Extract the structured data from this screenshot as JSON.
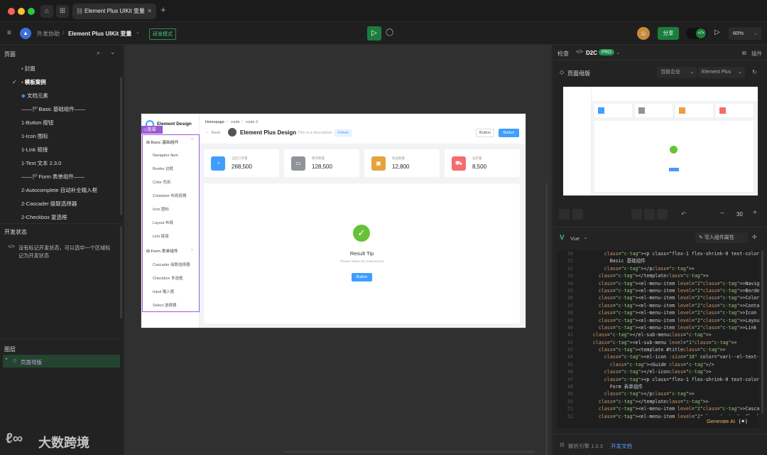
{
  "window": {
    "tab_title": "Element Plus UIKit 变量"
  },
  "toolbar": {
    "breadcrumb_team": "外发协助",
    "breadcrumb_sep": "/",
    "project_name": "Element Plus UIKit 变量",
    "dev_mode_badge": "研发模式",
    "share_label": "分享",
    "zoom": "60%"
  },
  "left": {
    "pages_title": "页面",
    "pages": [
      "封面",
      "模板案例",
      "文档元素",
      "——🏴Basic 基础组件——",
      "1-Button 按钮",
      "1-Icon 图标",
      "1-Link 链接",
      "1-Text 文本 2.3.0",
      "——🏴Form 表单组件——",
      "2-Autocomplete 自动补全输入框",
      "2-Cascader 级联选择器",
      "2-Checkbox 复选框"
    ],
    "dev_status_title": "开发状态",
    "dev_status_desc_1": "没有标记开发状态，可以选中一个区域标",
    "dev_status_desc_2": "记为开发状态",
    "layers_title": "图层",
    "layer_item": "页面母版",
    "watermark": "大数跨境"
  },
  "canvas": {
    "menu_tag": "菜单",
    "logo_text": "Element Design",
    "breadcrumb": [
      "Homepage",
      "/",
      "route",
      "/",
      "route 2"
    ],
    "back_label": "Back",
    "page_title": "Element Plus Design",
    "page_desc": "This is a description",
    "default_tag": "Default",
    "btn_default": "Button",
    "btn_primary": "Button",
    "menu_groups": [
      {
        "title": "Basic 基础组件",
        "items": [
          "Navigator Item",
          "Border 边框",
          "Color 色彩",
          "Container 布局容器",
          "Icon 图标",
          "Layout 布局",
          "Link 链接"
        ]
      },
      {
        "title": "Form 表单组件",
        "items": [
          "Cascader 级联选择器",
          "Checkbox 多选框",
          "Input 输入框",
          "Select 选择器"
        ]
      }
    ],
    "stats": [
      {
        "label": "当前订单量",
        "value": "268,500",
        "color": "#409eff"
      },
      {
        "label": "库存数量",
        "value": "128,500",
        "color": "#909399"
      },
      {
        "label": "商品数量",
        "value": "12,800",
        "color": "#e6a23c"
      },
      {
        "label": "运单量",
        "value": "8,500",
        "color": "#f56c6c"
      }
    ],
    "result_title": "Result Tip",
    "result_sub": "Please follow the instructions",
    "result_button": "Button"
  },
  "right": {
    "tab_inspect": "检查",
    "tab_d2c": "D2C",
    "pro_badge": "PRO",
    "plugin_label": "插件",
    "frame_name": "页面母版",
    "company_select": "当前企业",
    "lib_select": "Element Plus",
    "zoom_value": "30",
    "lang": "Vue",
    "write_props": "写入组件属性",
    "generate_ai": "Generate AI",
    "engine_version": "解析引擎 1.0.3",
    "dev_docs": "开发文档",
    "code": [
      {
        "n": "30",
        "t": "        <p class=\"flex-1 flex-shrink-0 text-color-prima"
      },
      {
        "n": "31",
        "t": "          Basic 基础组件"
      },
      {
        "n": "32",
        "t": "        </p>"
      },
      {
        "n": "33",
        "t": "      </template>"
      },
      {
        "n": "34",
        "t": "      <el-menu-item level=\"2\">Navigator Item</el-menu-i"
      },
      {
        "n": "35",
        "t": "      <el-menu-item level=\"2\">Border 边框</el-menu-item"
      },
      {
        "n": "36",
        "t": "      <el-menu-item level=\"2\">Color 色彩</el-menu-item>"
      },
      {
        "n": "37",
        "t": "      <el-menu-item level=\"2\">Container 布局容器</el-me"
      },
      {
        "n": "38",
        "t": "      <el-menu-item level=\"2\">Icon 图标</el-menu-item>"
      },
      {
        "n": "39",
        "t": "      <el-menu-item level=\"2\">Layout 布局</el-menu-item"
      },
      {
        "n": "40",
        "t": "      <el-menu-item level=\"2\">Link 链接</el-menu-item>"
      },
      {
        "n": "41",
        "t": "    </el-sub-menu>"
      },
      {
        "n": "42",
        "t": "    <el-sub-menu level=\"1\">"
      },
      {
        "n": "43",
        "t": "      <template #title>"
      },
      {
        "n": "44",
        "t": "        <el-icon :size=\"18\" color=\"var(--el-text-color-"
      },
      {
        "n": "45",
        "t": "          <Guide />"
      },
      {
        "n": "46",
        "t": "        </el-icon>"
      },
      {
        "n": "47",
        "t": "        <p class=\"flex-1 flex-shrink-0 text-color-prima"
      },
      {
        "n": "48",
        "t": "          Form 表单组件"
      },
      {
        "n": "49",
        "t": "        </p>"
      },
      {
        "n": "50",
        "t": "      </template>"
      },
      {
        "n": "51",
        "t": "      <el-menu-item level=\"2\">Cascader 级联选择器</el-m"
      },
      {
        "n": "52",
        "t": "      <el-menu-item level=\"2\">Checkbo"
      }
    ]
  }
}
